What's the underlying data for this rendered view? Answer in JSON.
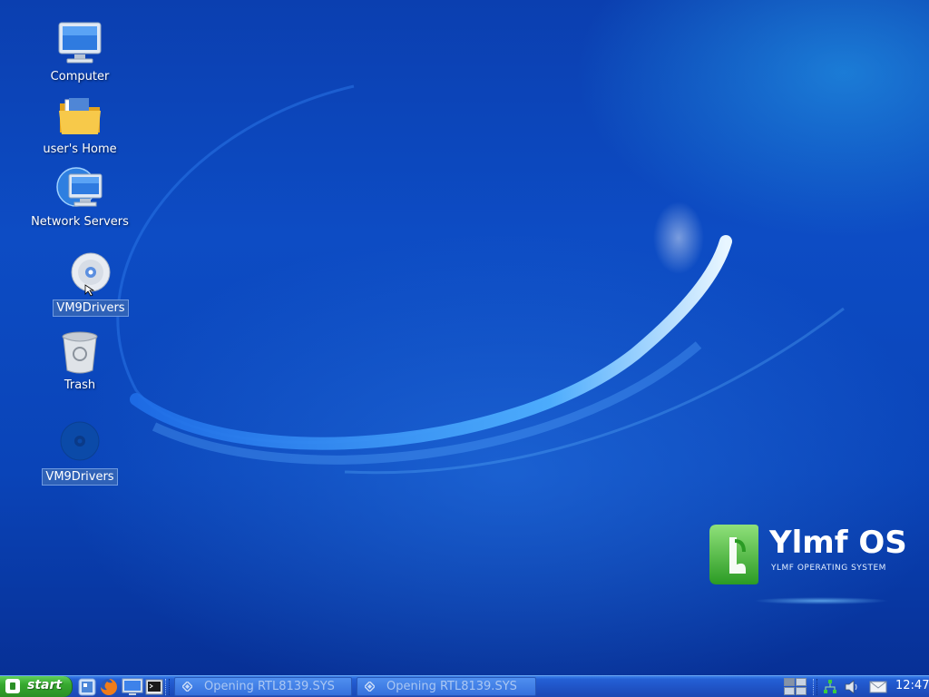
{
  "desktop": {
    "icons": [
      {
        "label": "Computer",
        "icon": "computer-icon"
      },
      {
        "label": "user's Home",
        "icon": "home-folder-icon"
      },
      {
        "label": "Network Servers",
        "icon": "network-icon"
      },
      {
        "label": "VM9Drivers",
        "icon": "cd-drive-icon"
      },
      {
        "label": "Trash",
        "icon": "trash-icon"
      },
      {
        "label": "VM9Drivers",
        "icon": "disc-icon"
      }
    ],
    "brand": {
      "name": "Ylmf OS",
      "subtitle": "YLMF OPERATING SYSTEM"
    }
  },
  "taskbar": {
    "start_label": "start",
    "quick_launch": [
      "finder-icon",
      "firefox-icon",
      "show-desktop-icon",
      "terminal-icon"
    ],
    "tasks": [
      {
        "label": "Opening RTL8139.SYS",
        "icon": "diamond-icon"
      },
      {
        "label": "Opening RTL8139.SYS",
        "icon": "diamond-icon"
      }
    ],
    "tray_icons": [
      "network-tray-icon",
      "volume-icon",
      "mail-icon"
    ],
    "clock": "12:47"
  },
  "colors": {
    "desktop_blue": "#0d4cc4",
    "taskbar_blue": "#2460d6",
    "start_green": "#37a92f",
    "brand_green": "#3cb034"
  }
}
